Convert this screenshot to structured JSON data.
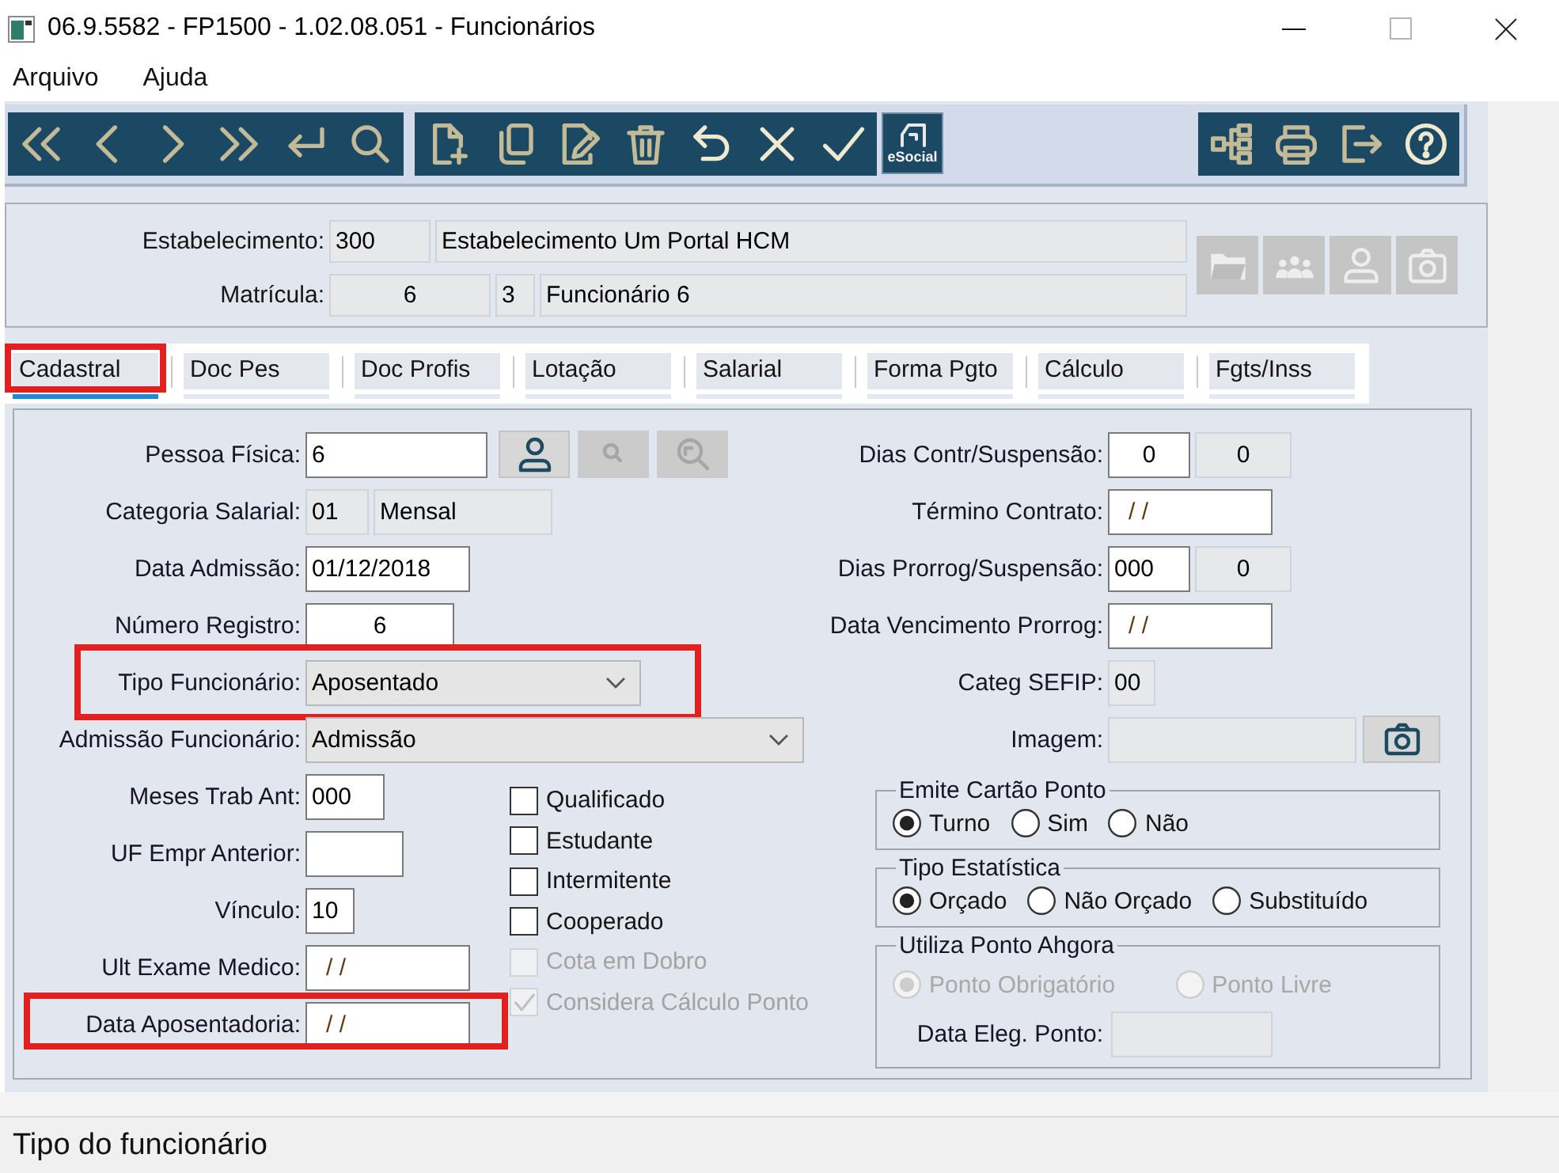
{
  "window": {
    "title": "06.9.5582 - FP1500 - 1.02.08.051 - Funcionários"
  },
  "menu": [
    "Arquivo",
    "Ajuda"
  ],
  "toolbar": {
    "esocial_label": "eSocial"
  },
  "header": {
    "fields": [
      {
        "label": "Estabelecimento:",
        "inputs": [
          {
            "value": "300",
            "read_only": true
          },
          {
            "value": "Estabelecimento Um Portal HCM",
            "read_only": true
          }
        ]
      },
      {
        "label": "Matrícula:",
        "inputs": [
          {
            "value": "6",
            "read_only": true
          },
          {
            "value": "3",
            "read_only": true
          },
          {
            "value": "Funcionário 6",
            "read_only": true
          }
        ]
      }
    ],
    "buttons": [
      {
        "disabled": true
      },
      {
        "disabled": true
      },
      {
        "disabled": true
      },
      {
        "disabled": true
      }
    ]
  },
  "tabs": [
    {
      "label": "Cadastral",
      "selected": true,
      "highlighted": true
    },
    {
      "label": "Doc Pes",
      "selected": false,
      "highlighted": false
    },
    {
      "label": "Doc Profis",
      "selected": false,
      "highlighted": false
    },
    {
      "label": "Lotação",
      "selected": false,
      "highlighted": false
    },
    {
      "label": "Salarial",
      "selected": false,
      "highlighted": false
    },
    {
      "label": "Forma Pgto",
      "selected": false,
      "highlighted": false
    },
    {
      "label": "Cálculo",
      "selected": false,
      "highlighted": false
    },
    {
      "label": "Fgts/Inss",
      "selected": false,
      "highlighted": false
    }
  ],
  "left_fields": [
    {
      "label": "Pessoa Física:",
      "kind": "lookup",
      "highlighted": false,
      "inputs": [
        {
          "kind": "text",
          "value": "6",
          "read_only": false
        }
      ],
      "buttons": [
        {
          "disabled": false
        },
        {
          "disabled": true
        },
        {
          "disabled": true
        }
      ]
    },
    {
      "label": "Categoria Salarial:",
      "kind": "plain",
      "highlighted": false,
      "inputs": [
        {
          "kind": "text",
          "value": "01",
          "read_only": true
        },
        {
          "kind": "text",
          "value": "Mensal",
          "read_only": true
        }
      ]
    },
    {
      "label": "Data Admissão:",
      "kind": "plain",
      "highlighted": false,
      "inputs": [
        {
          "kind": "text",
          "value": "01/12/2018",
          "read_only": false
        }
      ]
    },
    {
      "label": "Número Registro:",
      "kind": "plain",
      "highlighted": false,
      "inputs": [
        {
          "kind": "text",
          "value": "6",
          "read_only": false
        }
      ]
    },
    {
      "label": "Tipo Funcionário:",
      "kind": "plain",
      "highlighted": true,
      "inputs": [
        {
          "kind": "select",
          "value": "Aposentado",
          "read_only": false
        }
      ]
    },
    {
      "label": "Admissão Funcionário:",
      "kind": "plain",
      "highlighted": false,
      "inputs": [
        {
          "kind": "select",
          "value": "Admissão",
          "read_only": false
        }
      ]
    },
    {
      "label": "Meses Trab Ant:",
      "kind": "plain",
      "highlighted": false,
      "inputs": [
        {
          "kind": "text",
          "value": "000",
          "read_only": false
        }
      ]
    },
    {
      "label": "UF Empr Anterior:",
      "kind": "plain",
      "highlighted": false,
      "inputs": [
        {
          "kind": "text",
          "read_only": false
        }
      ]
    },
    {
      "label": "Vínculo:",
      "kind": "plain",
      "highlighted": false,
      "inputs": [
        {
          "kind": "text",
          "value": "10",
          "read_only": false
        }
      ]
    },
    {
      "label": "Ult Exame Medico:",
      "kind": "plain",
      "highlighted": false,
      "inputs": [
        {
          "kind": "mask",
          "value": "/ /",
          "read_only": false
        }
      ]
    },
    {
      "label": "Data Aposentadoria:",
      "kind": "plain",
      "highlighted": true,
      "inputs": [
        {
          "kind": "mask",
          "value": "/ /",
          "read_only": false
        }
      ]
    }
  ],
  "checkboxes": [
    {
      "label": "Qualificado",
      "checked": false,
      "disabled": false
    },
    {
      "label": "Estudante",
      "checked": false,
      "disabled": false
    },
    {
      "label": "Intermitente",
      "checked": false,
      "disabled": false
    },
    {
      "label": "Cooperado",
      "checked": false,
      "disabled": false
    },
    {
      "label": "Cota em Dobro",
      "checked": false,
      "disabled": true
    },
    {
      "label": "Considera Cálculo Ponto",
      "checked": true,
      "disabled": true
    }
  ],
  "right_fields": [
    {
      "label": "Dias Contr/Suspensão:",
      "kind": "plain",
      "inputs": [
        {
          "kind": "text",
          "value": "0",
          "read_only": false
        },
        {
          "kind": "text",
          "value": "0",
          "read_only": true
        }
      ]
    },
    {
      "label": "Término Contrato:",
      "kind": "plain",
      "inputs": [
        {
          "kind": "mask",
          "value": "/ /",
          "read_only": false
        }
      ]
    },
    {
      "label": "Dias Prorrog/Suspensão:",
      "kind": "plain",
      "inputs": [
        {
          "kind": "text",
          "value": "000",
          "read_only": false
        },
        {
          "kind": "text",
          "value": "0",
          "read_only": true
        }
      ]
    },
    {
      "label": "Data Vencimento Prorrog:",
      "kind": "plain",
      "inputs": [
        {
          "kind": "mask",
          "value": "/ /",
          "read_only": false
        }
      ]
    },
    {
      "label": "Categ SEFIP:",
      "kind": "plain",
      "inputs": [
        {
          "kind": "text",
          "value": "00",
          "read_only": true
        }
      ]
    },
    {
      "label": "Imagem:",
      "kind": "image",
      "inputs": [
        {
          "kind": "text",
          "read_only": true
        }
      ],
      "buttons": [
        {
          "disabled": false
        }
      ]
    }
  ],
  "radio_groups": [
    {
      "title": "Emite Cartão Ponto",
      "options": [
        {
          "label": "Turno",
          "selected": true,
          "disabled": false
        },
        {
          "label": "Sim",
          "selected": false,
          "disabled": false
        },
        {
          "label": "Não",
          "selected": false,
          "disabled": false
        }
      ]
    },
    {
      "title": "Tipo Estatística",
      "options": [
        {
          "label": "Orçado",
          "selected": true,
          "disabled": false
        },
        {
          "label": "Não Orçado",
          "selected": false,
          "disabled": false
        },
        {
          "label": "Substituído",
          "selected": false,
          "disabled": false
        }
      ]
    },
    {
      "title": "Utiliza Ponto Ahgora",
      "options": [
        {
          "label": "Ponto Obrigatório",
          "selected": true,
          "disabled": true
        },
        {
          "label": "Ponto Livre",
          "selected": false,
          "disabled": true
        }
      ],
      "field": {
        "label": "Data Eleg. Ponto:",
        "read_only": true
      }
    }
  ],
  "status_bar": {
    "text": "Tipo do funcionário"
  }
}
